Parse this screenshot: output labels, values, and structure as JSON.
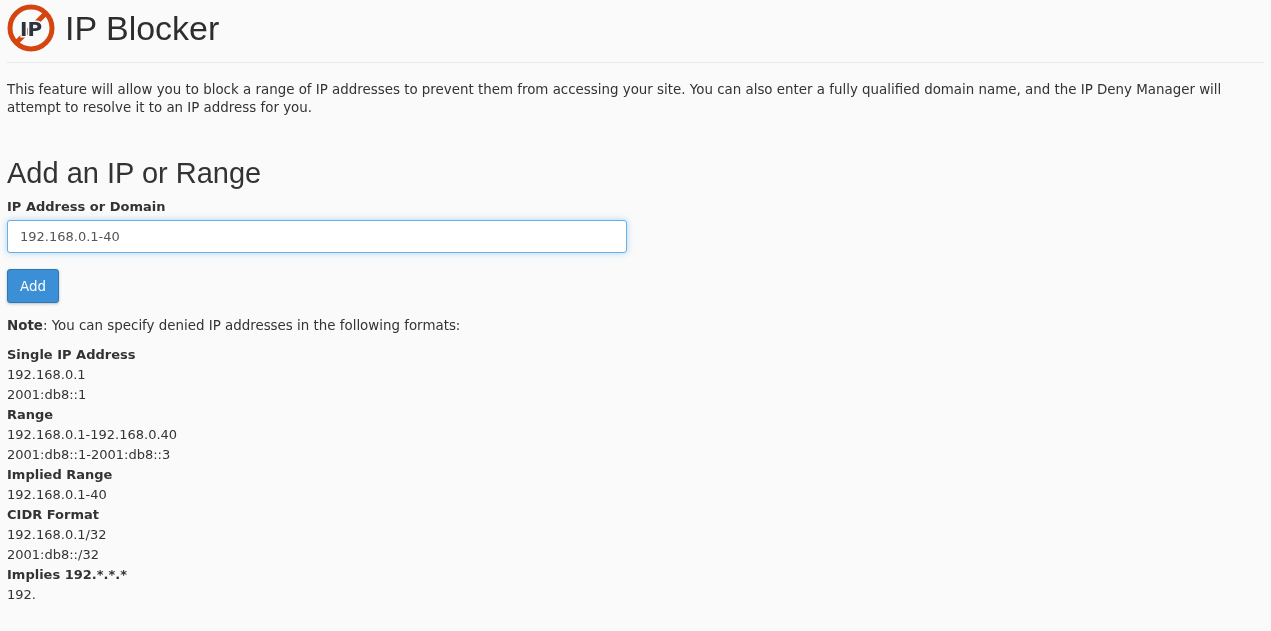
{
  "header": {
    "logo_text": "IP",
    "title": "IP Blocker"
  },
  "description": "This feature will allow you to block a range of IP addresses to prevent them from accessing your site. You can also enter a fully qualified domain name, and the IP Deny Manager will attempt to resolve it to an IP address for you.",
  "form": {
    "heading": "Add an IP or Range",
    "label": "IP Address or Domain",
    "value": "192.168.0.1-40",
    "button": "Add"
  },
  "note": "**Note**: You can specify denied IP addresses in the following formats:",
  "formats": [
    {
      "title": "Single IP Address",
      "examples": [
        "192.168.0.1",
        "2001:db8::1"
      ]
    },
    {
      "title": "Range",
      "examples": [
        "192.168.0.1-192.168.0.40",
        "2001:db8::1-2001:db8::3"
      ]
    },
    {
      "title": "Implied Range",
      "examples": [
        "192.168.0.1-40"
      ]
    },
    {
      "title": "CIDR Format",
      "examples": [
        "192.168.0.1/32",
        "2001:db8::/32"
      ]
    },
    {
      "title": "Implies 192.*.*.*",
      "examples": [
        "192."
      ]
    }
  ]
}
